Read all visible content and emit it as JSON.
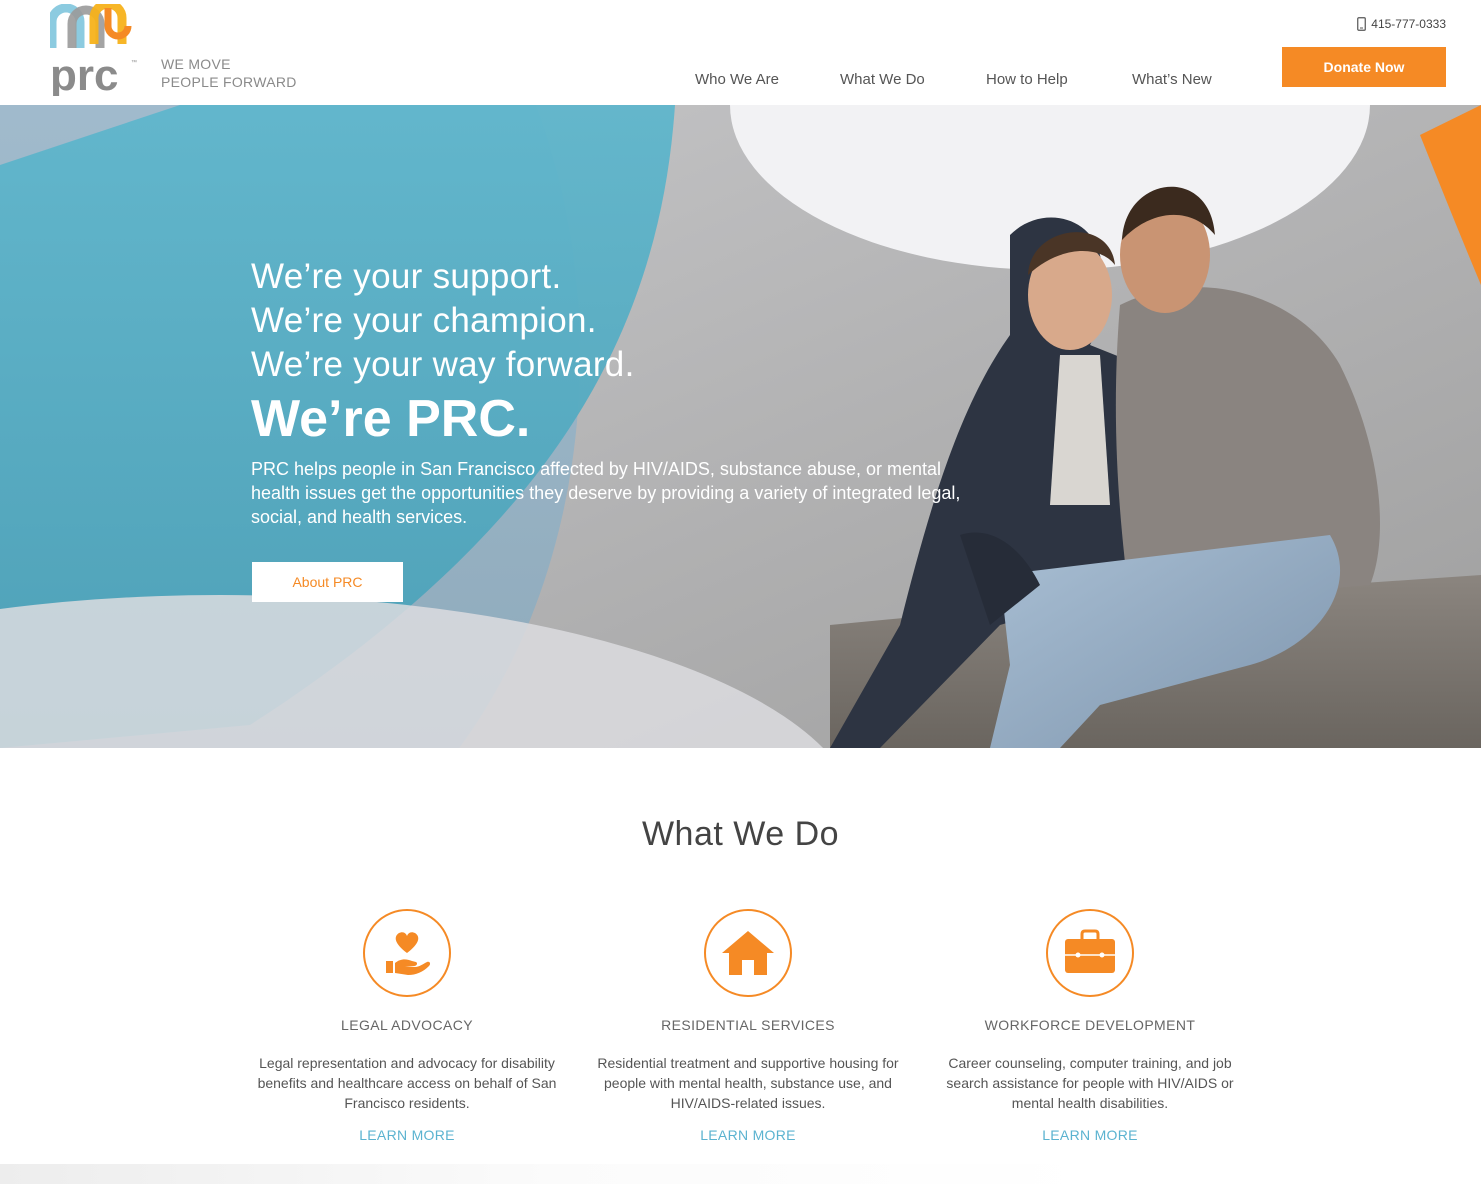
{
  "header": {
    "logo_text": "prc",
    "tagline_line1": "WE MOVE",
    "tagline_line2": "PEOPLE FORWARD",
    "phone": "415-777-0333",
    "nav": [
      {
        "label": "Who We Are"
      },
      {
        "label": "What We Do"
      },
      {
        "label": "How to Help"
      },
      {
        "label": "What’s New"
      }
    ],
    "donate_label": "Donate Now"
  },
  "hero": {
    "line1": "We’re your support.",
    "line2": "We’re your champion.",
    "line3": "We’re your way forward.",
    "title": "We’re PRC.",
    "description": "PRC helps people in San Francisco affected by HIV/AIDS, substance abuse, or mental health issues get the opportunities they deserve by providing a variety of integrated legal, social, and health services.",
    "button_label": "About PRC"
  },
  "what_we_do": {
    "title": "What We Do",
    "cards": [
      {
        "icon": "heart-hand-icon",
        "title": "LEGAL ADVOCACY",
        "description": "Legal representation and advocacy for disability benefits and healthcare access on behalf of San Francisco residents.",
        "link": "LEARN MORE"
      },
      {
        "icon": "house-icon",
        "title": "RESIDENTIAL SERVICES",
        "description": "Residential treatment and supportive housing for people with mental health, substance use, and HIV/AIDS-related issues.",
        "link": "LEARN MORE"
      },
      {
        "icon": "briefcase-icon",
        "title": "WORKFORCE DEVELOPMENT",
        "description": "Career counseling, computer training, and job search assistance for people with HIV/AIDS or mental health disabilities.",
        "link": "LEARN MORE"
      }
    ]
  },
  "colors": {
    "accent_orange": "#f58a25",
    "link_blue": "#5bb3d0",
    "logo_blue": "#8ccbe0",
    "logo_gray": "#8b8b8b",
    "logo_yellow": "#f7b21b"
  }
}
